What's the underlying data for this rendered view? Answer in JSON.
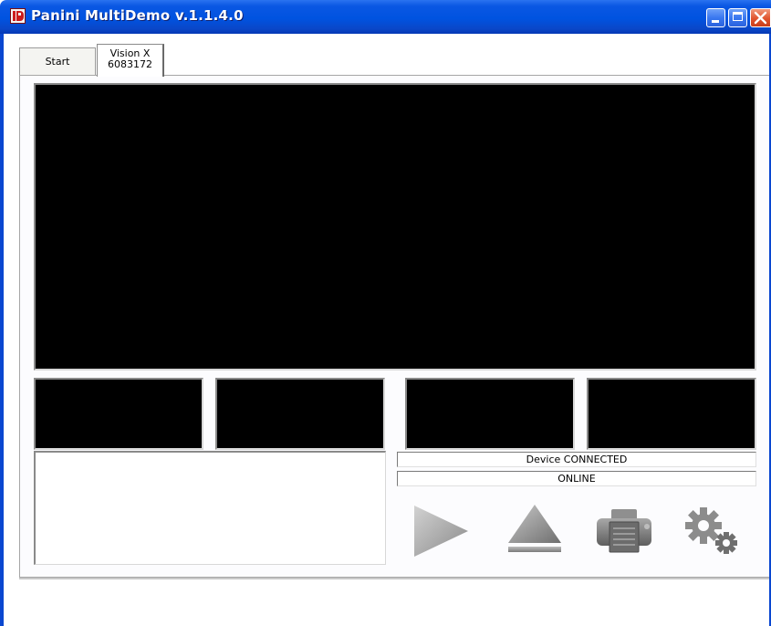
{
  "window": {
    "title": "Panini MultiDemo v.1.1.4.0"
  },
  "tabs": {
    "start": "Start",
    "device_line1": "Vision X",
    "device_line2": "6083172"
  },
  "status": {
    "device": "Device CONNECTED",
    "mode": "ONLINE"
  },
  "toolbar": {
    "icons": [
      "play-icon",
      "eject-icon",
      "printer-icon",
      "settings-gears-icon"
    ]
  },
  "colors": {
    "titlebar": "#0053e0",
    "image_view": "#000000",
    "icon_gray": "#8c8c8c"
  }
}
